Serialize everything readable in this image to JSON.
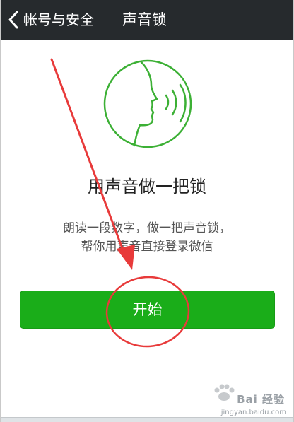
{
  "navbar": {
    "back_label": "帐号与安全",
    "title": "声音锁"
  },
  "main": {
    "heading": "用声音做一把锁",
    "description_line1": "朗读一段数字，做一把声音锁，",
    "description_line2": "帮你用声音直接登录微信",
    "start_button": "开始"
  },
  "watermark": {
    "brand": "Bai 经验",
    "url": "jingyan.baidu.com"
  },
  "icons": {
    "back": "chevron-left-icon",
    "voice": "voice-face-icon"
  },
  "colors": {
    "navbar": "#262a2d",
    "accent_green": "#1aad19",
    "icon_green": "#3cb035",
    "annotation_red": "#e83a3a"
  }
}
